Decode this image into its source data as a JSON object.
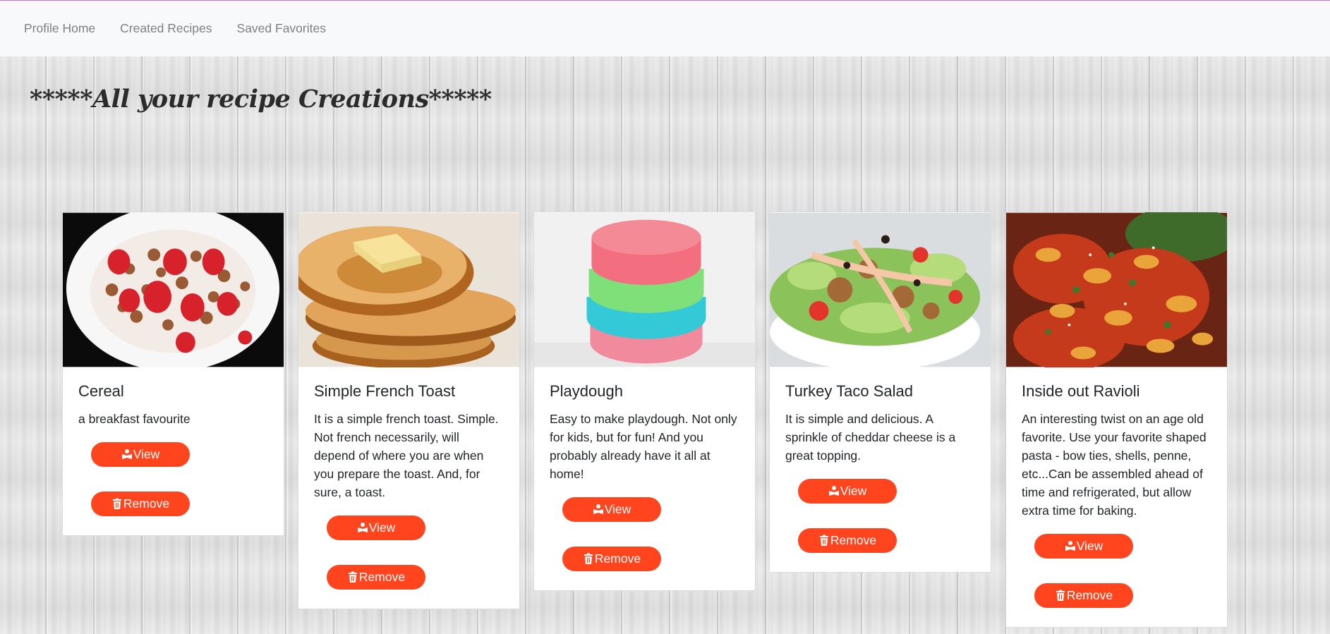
{
  "nav": {
    "items": [
      {
        "label": "Profile Home"
      },
      {
        "label": "Created Recipes"
      },
      {
        "label": "Saved Favorites"
      }
    ]
  },
  "page": {
    "heading": "*****All your recipe Creations*****"
  },
  "buttons": {
    "view_label": "View",
    "remove_label": "Remove",
    "view_icon": "reader-icon",
    "remove_icon": "trash-icon",
    "color": "#ff441e"
  },
  "recipes": [
    {
      "title": "Cereal",
      "description": "a breakfast favourite",
      "image": "cereal-strawberries-photo"
    },
    {
      "title": "Simple French Toast",
      "description": "It is a simple french toast. Simple. Not french necessarily, will depend of where you are when you prepare the toast. And, for sure, a toast.",
      "image": "french-toast-photo"
    },
    {
      "title": "Playdough",
      "description": "Easy to make playdough. Not only for kids, but for fun! And you probably already have it all at home!",
      "image": "playdough-stack-photo"
    },
    {
      "title": "Turkey Taco Salad",
      "description": "It is simple and delicious. A sprinkle of cheddar cheese is a great topping.",
      "image": "taco-salad-photo"
    },
    {
      "title": "Inside out Ravioli",
      "description": "An interesting twist on an age old favorite. Use your favorite shaped pasta - bow ties, shells, penne, etc...Can be assembled ahead of time and refrigerated, but allow extra time for baking.",
      "image": "pasta-bake-photo"
    }
  ]
}
